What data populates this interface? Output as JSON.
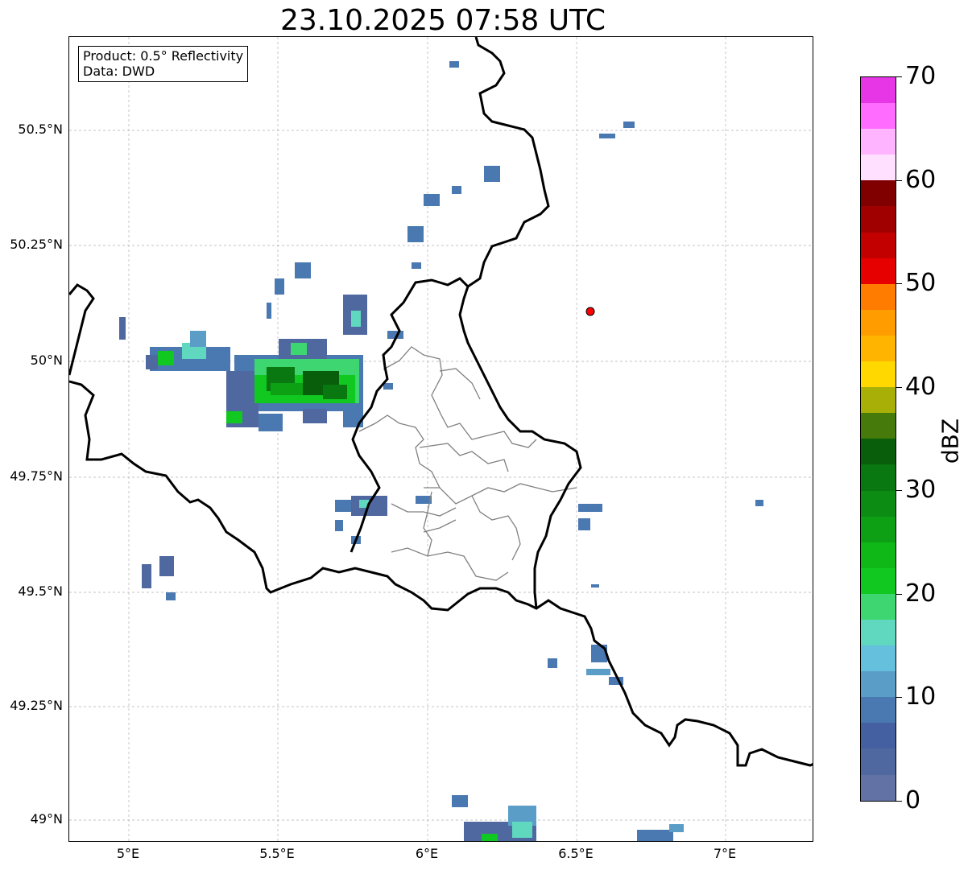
{
  "title": "23.10.2025 07:58 UTC",
  "info": {
    "product": "Product: 0.5° Reflectivity",
    "data": "Data: DWD"
  },
  "axes": {
    "lat_ticks": [
      "50.5°N",
      "50.25°N",
      "50°N",
      "49.75°N",
      "49.5°N",
      "49.25°N",
      "49°N"
    ],
    "lon_ticks": [
      "5°E",
      "5.5°E",
      "6°E",
      "6.5°E",
      "7°E"
    ]
  },
  "colorbar": {
    "label": "dBZ",
    "ticks": [
      "0",
      "10",
      "20",
      "30",
      "40",
      "50",
      "60",
      "70"
    ],
    "colors": [
      "#6272a4",
      "#5068a0",
      "#4460a0",
      "#4a78b0",
      "#5a9ec8",
      "#64c0dc",
      "#60d8c0",
      "#3ed670",
      "#10c820",
      "#0fb816",
      "#0ea014",
      "#0c8c12",
      "#0a7810",
      "#085e0a",
      "#467a0a",
      "#a8b008",
      "#ffd800",
      "#ffb400",
      "#ff9c00",
      "#ff7c00",
      "#e60000",
      "#c20000",
      "#a00000",
      "#800000",
      "#ffe0ff",
      "#ffb4ff",
      "#ff6cff",
      "#e636e6"
    ]
  },
  "marker": {
    "name": "radar-site-marker",
    "color": "#ff0000"
  },
  "colors": {
    "border": "#000000",
    "admin": "#808080",
    "grid": "#b0b0b0"
  }
}
